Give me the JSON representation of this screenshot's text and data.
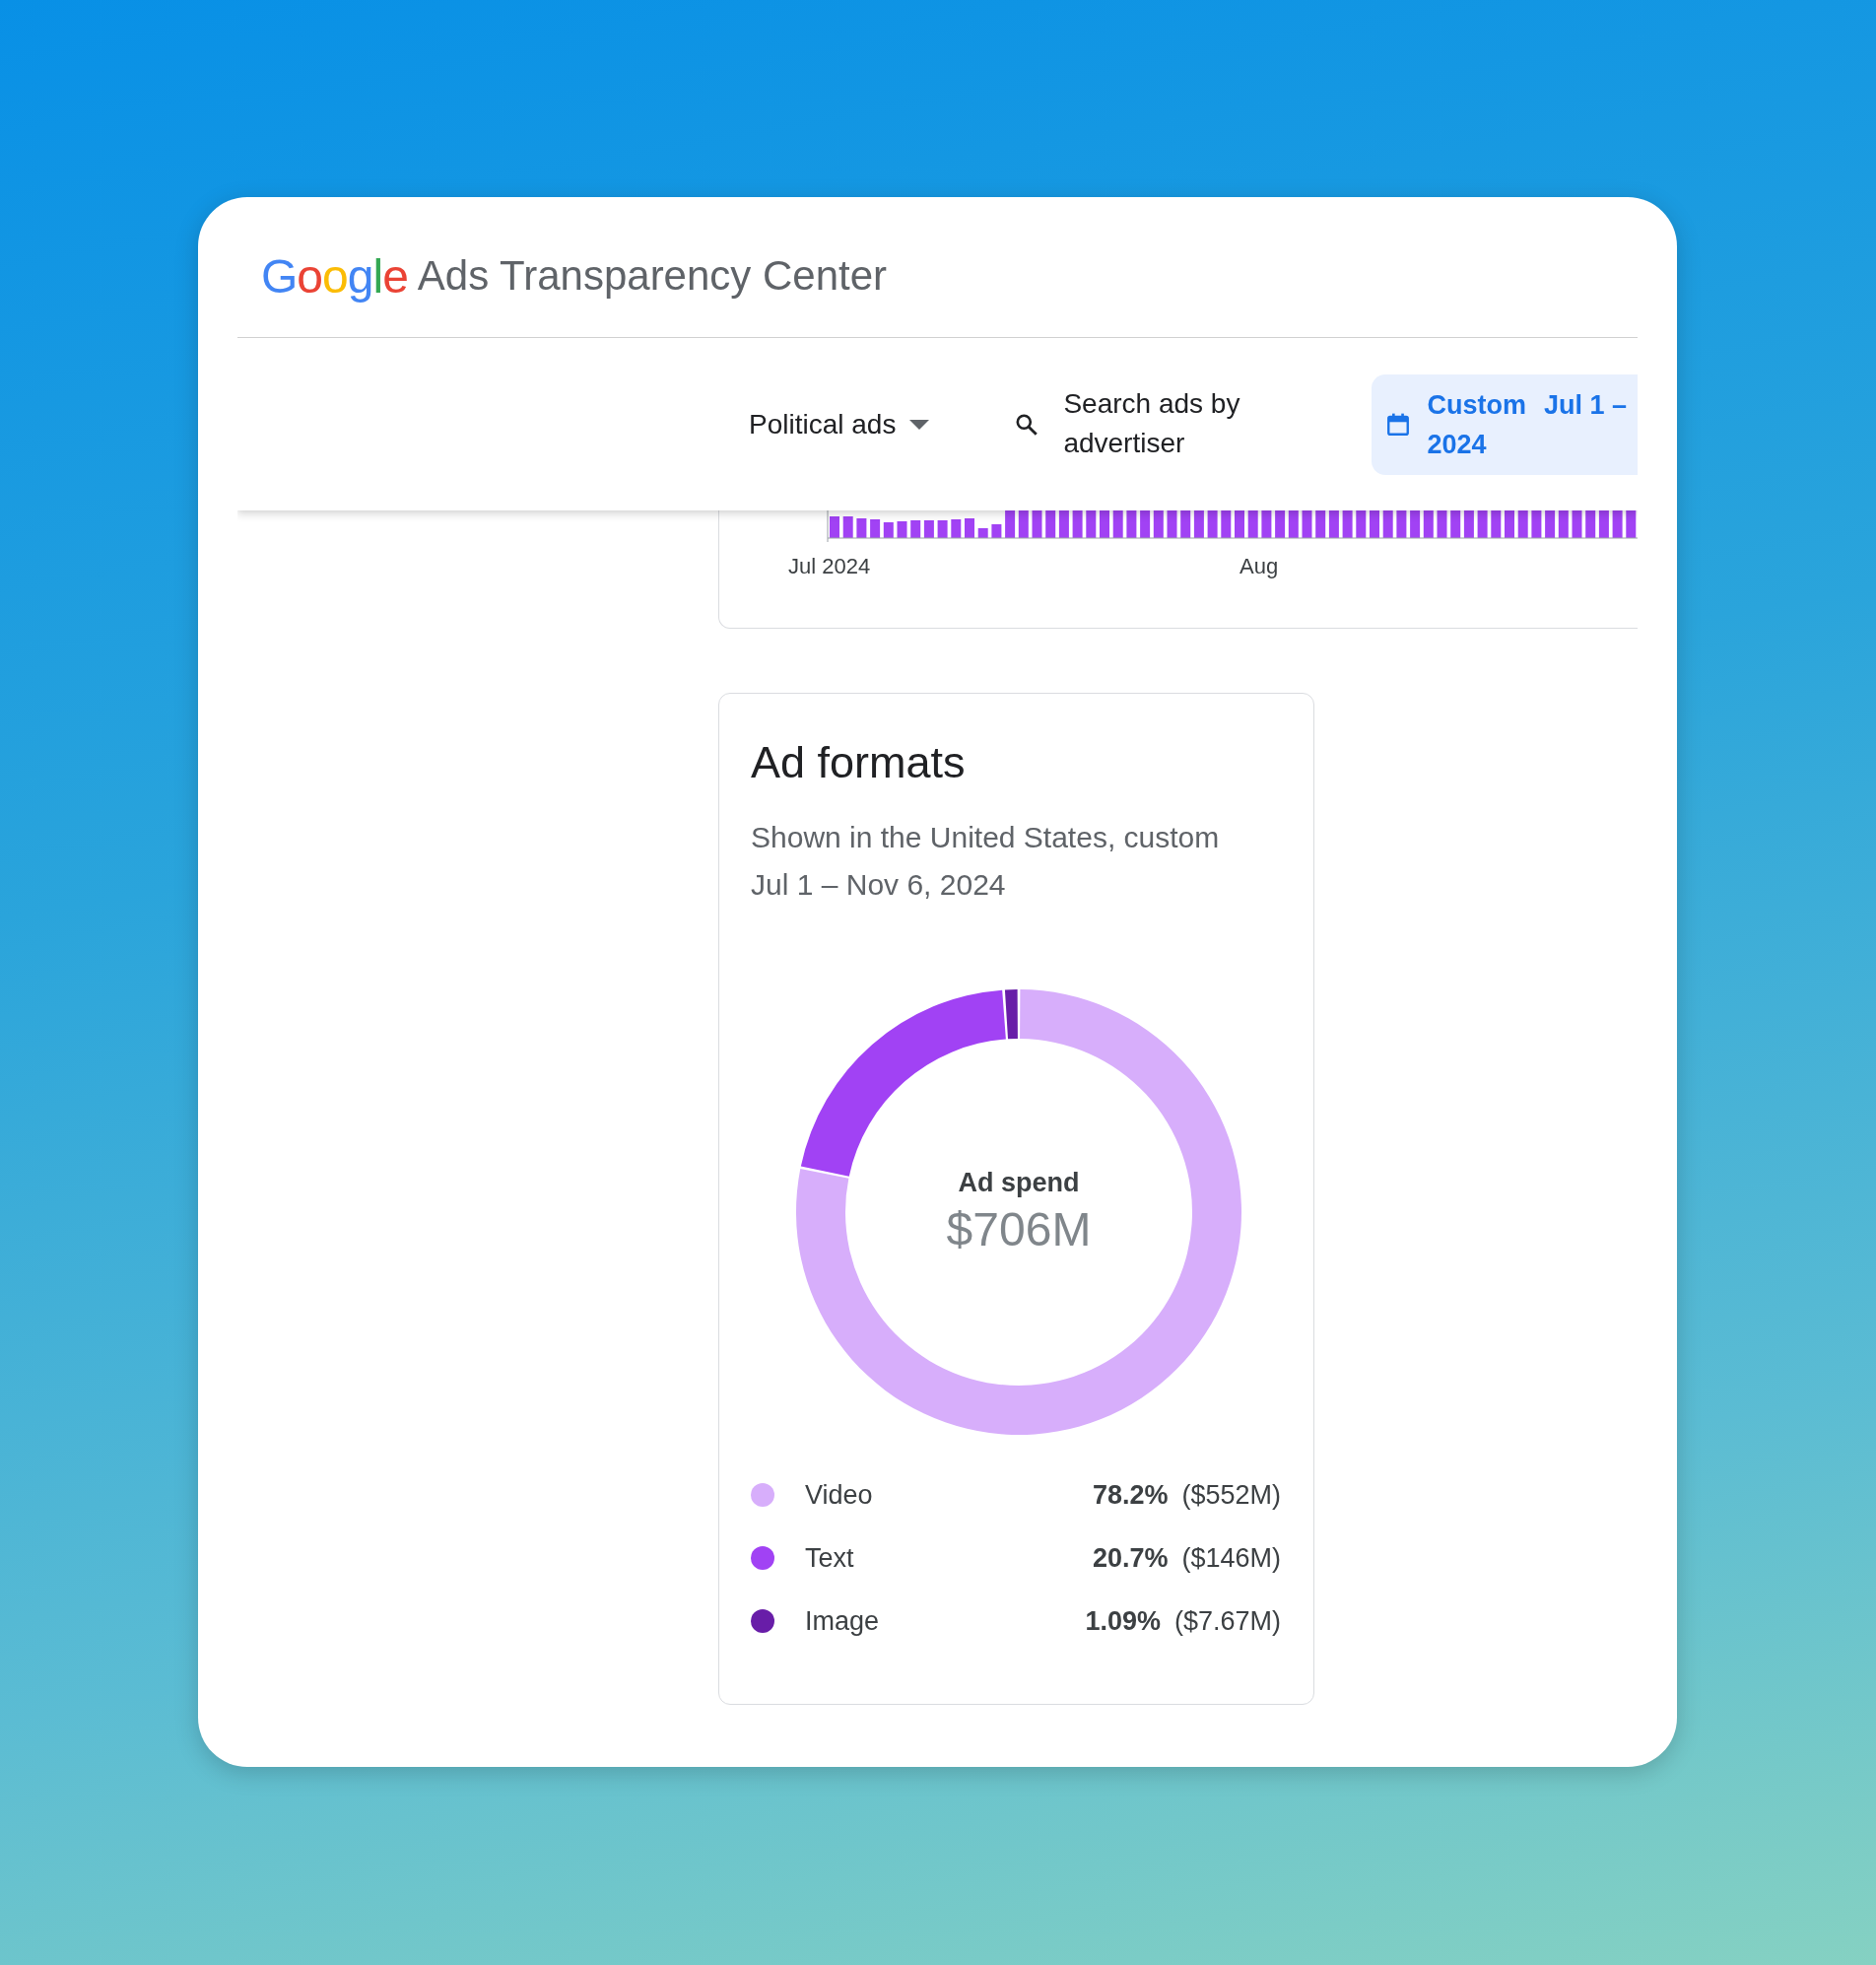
{
  "header": {
    "logo": "Google",
    "title": "Ads Transparency Center"
  },
  "toolbar": {
    "ad_type": "Political ads",
    "search": {
      "placeholder": "Search ads by advertiser"
    },
    "date_range": {
      "label": "Custom",
      "range": "Jul 1 –",
      "year": "2024"
    }
  },
  "timeline": {
    "axis_labels": [
      "Jul 2024",
      "Aug"
    ]
  },
  "ad_formats": {
    "title": "Ad formats",
    "subtitle": "Shown in the United States, custom Jul 1 – Nov 6, 2024",
    "center_value": "$706M",
    "chart_data": {
      "type": "donut",
      "categories": [
        "Video",
        "Text",
        "Image"
      ],
      "series": [
        {
          "name": "Ad spend",
          "values": [
            78.2,
            20.7,
            1.09
          ]
        }
      ]
    },
    "legend": [
      {
        "percent": "78.2%",
        "amount": "($552M)",
        "color": "#d7aefb"
      },
      {
        "percent": "20.7%",
        "amount": "($146M)",
        "color": "#a142f4"
      },
      {
        "percent": "1.09%",
        "amount": "($7.67M)",
        "color": "#681da8"
      }
    ]
  }
}
